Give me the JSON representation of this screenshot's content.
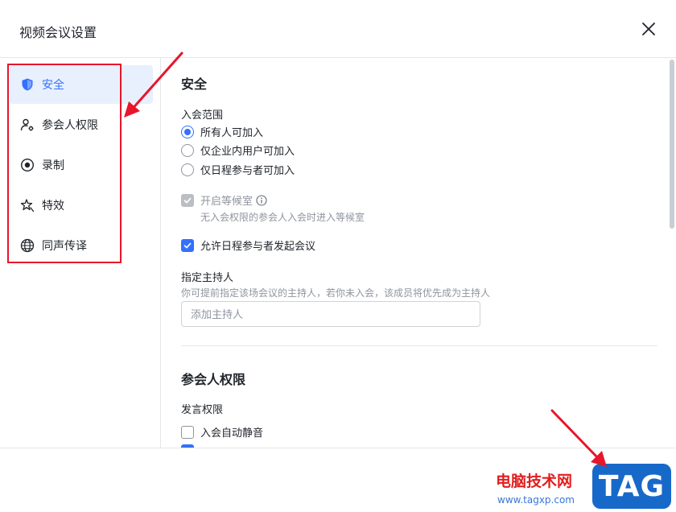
{
  "dialog": {
    "title": "视频会议设置"
  },
  "sidebar": {
    "items": [
      {
        "label": "安全",
        "icon": "shield-icon"
      },
      {
        "label": "参会人权限",
        "icon": "user-settings-icon"
      },
      {
        "label": "录制",
        "icon": "record-icon"
      },
      {
        "label": "特效",
        "icon": "sparkle-icon"
      },
      {
        "label": "同声传译",
        "icon": "globe-icon"
      }
    ],
    "active_index": 0
  },
  "security": {
    "title": "安全",
    "join_scope_label": "入会范围",
    "options": [
      {
        "label": "所有人可加入",
        "selected": true
      },
      {
        "label": "仅企业内用户可加入",
        "selected": false
      },
      {
        "label": "仅日程参与者可加入",
        "selected": false
      }
    ],
    "waiting_room": {
      "label": "开启等候室",
      "desc": "无入会权限的参会人入会时进入等候室",
      "checked": true,
      "disabled": true
    },
    "allow_start": {
      "label": "允许日程参与者发起会议",
      "checked": true
    },
    "host": {
      "label": "指定主持人",
      "desc": "你可提前指定该场会议的主持人，若你未入会，该成员将优先成为主持人",
      "placeholder": "添加主持人"
    }
  },
  "permissions": {
    "title": "参会人权限",
    "speak_label": "发言权限",
    "auto_mute": {
      "label": "入会自动静音",
      "checked": false
    }
  },
  "watermark": {
    "site_name": "电脑技术网",
    "url": "www.tagxp.com",
    "logo_text": "TAG"
  },
  "colors": {
    "accent": "#3370ff",
    "annotation": "#e8152b"
  }
}
